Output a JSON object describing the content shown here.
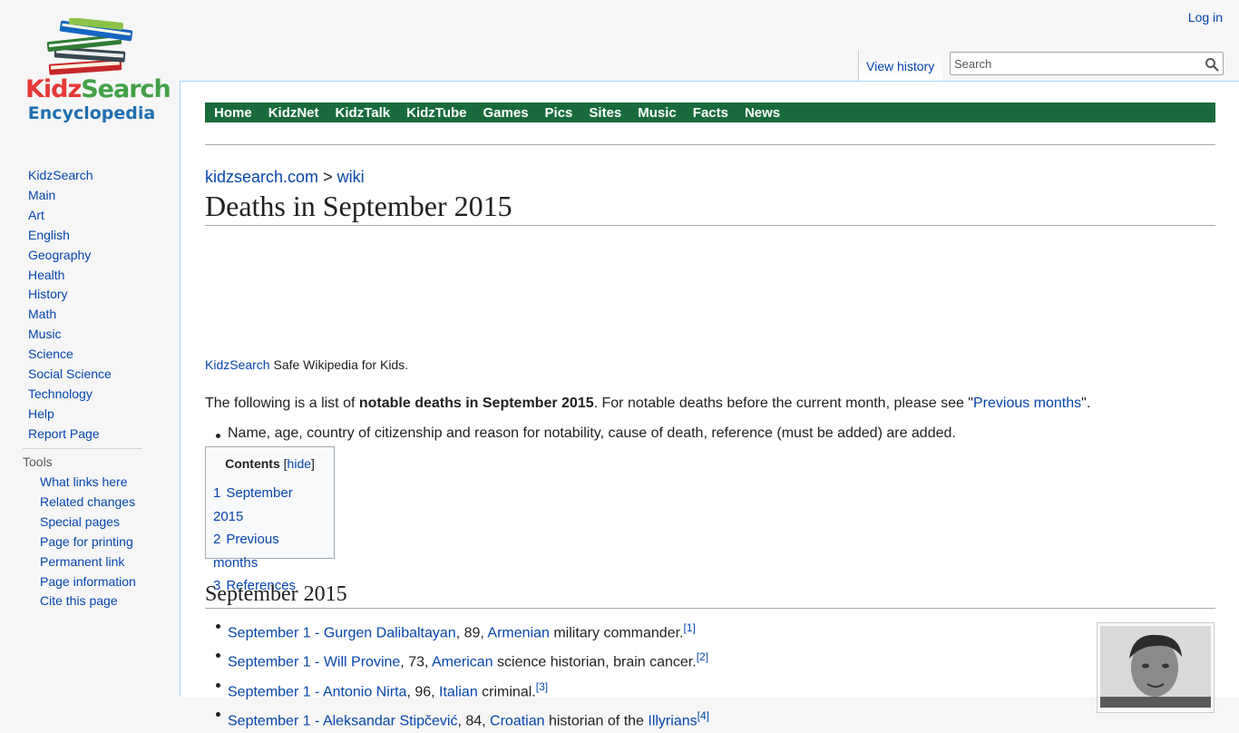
{
  "logo": {
    "kidz_part1": "Kidz",
    "kidz_part2": "Search",
    "line2": "Encyclopedia"
  },
  "sidebar": {
    "items": [
      {
        "label": "KidzSearch"
      },
      {
        "label": "Main"
      },
      {
        "label": "Art"
      },
      {
        "label": "English"
      },
      {
        "label": "Geography"
      },
      {
        "label": "Health"
      },
      {
        "label": "History"
      },
      {
        "label": "Math"
      },
      {
        "label": "Music"
      },
      {
        "label": "Science"
      },
      {
        "label": "Social Science"
      },
      {
        "label": "Technology"
      },
      {
        "label": "Help"
      },
      {
        "label": "Report Page"
      }
    ],
    "tools_heading": "Tools",
    "tools": [
      {
        "label": "What links here"
      },
      {
        "label": "Related changes"
      },
      {
        "label": "Special pages"
      },
      {
        "label": "Page for printing"
      },
      {
        "label": "Permanent link"
      },
      {
        "label": "Page information"
      },
      {
        "label": "Cite this page"
      }
    ]
  },
  "header": {
    "login": "Log in",
    "view_history": "View history",
    "search_placeholder": "Search"
  },
  "topnav": [
    "Home",
    "KidzNet",
    "KidzTalk",
    "KidzTube",
    "Games",
    "Pics",
    "Sites",
    "Music",
    "Facts",
    "News"
  ],
  "breadcrumb": {
    "site": "kidzsearch.com",
    "sep": ">",
    "section": "wiki"
  },
  "page_title": "Deaths in September 2015",
  "tagline": {
    "link": "KidzSearch",
    "text": " Safe Wikipedia for Kids."
  },
  "intro": {
    "before": "The following is a list of ",
    "bold": "notable deaths in September 2015",
    "middle": ". For notable deaths before the current month, please see \"",
    "link": "Previous months",
    "after": "\"."
  },
  "note": "Name, age, country of citizenship and reason for notability, cause of death, reference (must be added) are added.",
  "toc": {
    "title": "Contents",
    "hide_open": "[",
    "hide": "hide",
    "hide_close": "]",
    "items": [
      {
        "num": "1",
        "label": "September 2015"
      },
      {
        "num": "2",
        "label": "Previous months"
      },
      {
        "num": "3",
        "label": "References"
      }
    ]
  },
  "section_heading": "September 2015",
  "entries": [
    {
      "link": "September 1 - Gurgen Dalibaltayan",
      "age": ", 89, ",
      "country": "Armenian",
      "desc": " military commander.",
      "ref": "[1]"
    },
    {
      "link": "September 1 - Will Provine",
      "age": ", 73, ",
      "country": "American",
      "desc": " science historian, brain cancer.",
      "ref": "[2]"
    },
    {
      "link": "September 1 - Antonio Nirta",
      "age": ", 96, ",
      "country": "Italian",
      "desc": " criminal.",
      "ref": "[3]"
    },
    {
      "link": "September 1 - Aleksandar Stipčević",
      "age": ", 84, ",
      "country": "Croatian",
      "desc": " historian of the ",
      "extra_link": "Illyrians",
      "ref": "[4]"
    }
  ],
  "colors": {
    "nav_green": "#1a6b3c",
    "link": "#0645ad"
  }
}
